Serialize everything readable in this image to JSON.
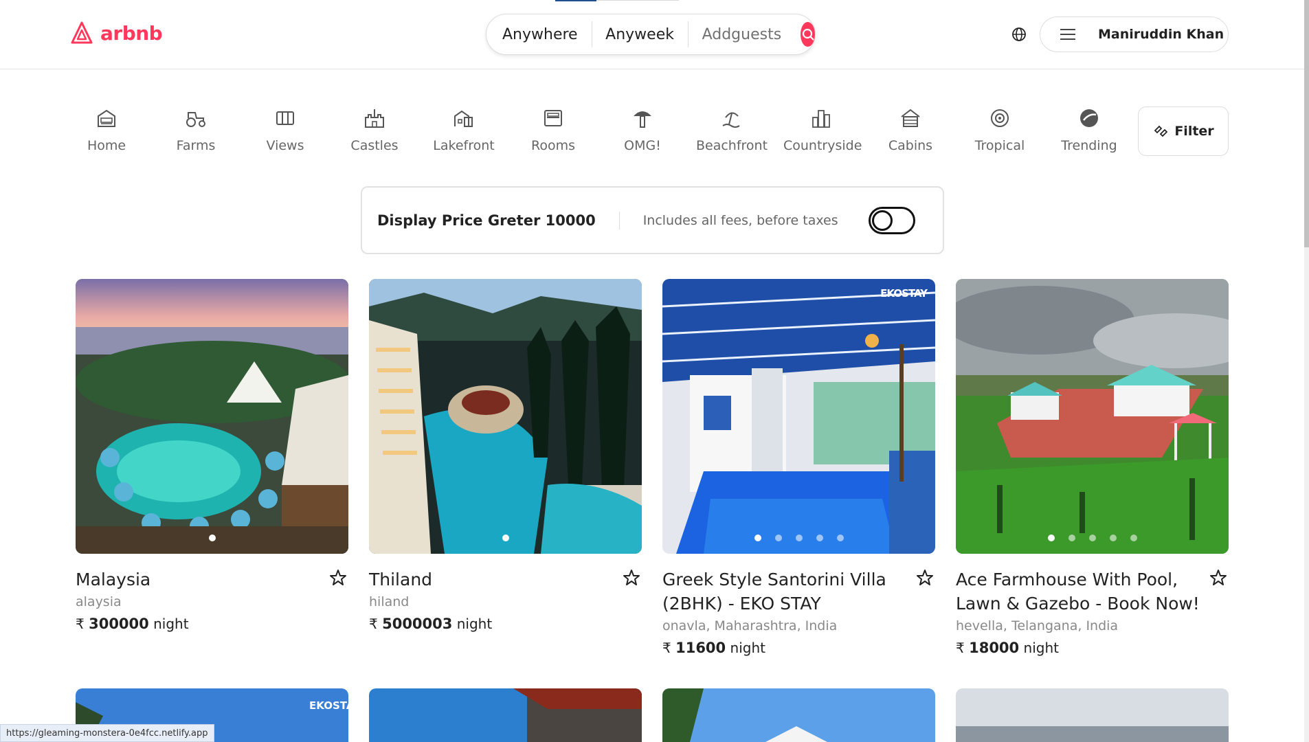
{
  "header": {
    "logo_text": "arbnb",
    "search": {
      "anywhere": "Anywhere",
      "anyweek": "Anyweek",
      "addguests": "Addguests"
    },
    "user_name": "Maniruddin Khan"
  },
  "categories": [
    {
      "label": "Home",
      "icon": "house-icon"
    },
    {
      "label": "Farms",
      "icon": "tractor-icon"
    },
    {
      "label": "Views",
      "icon": "columns-icon"
    },
    {
      "label": "Castles",
      "icon": "castle-icon"
    },
    {
      "label": "Lakefront",
      "icon": "lakefront-icon"
    },
    {
      "label": "Rooms",
      "icon": "bed-icon"
    },
    {
      "label": "OMG!",
      "icon": "mushroom-icon"
    },
    {
      "label": "Beachfront",
      "icon": "beach-icon"
    },
    {
      "label": "Countryside",
      "icon": "city-icon"
    },
    {
      "label": "Cabins",
      "icon": "cabin-icon"
    },
    {
      "label": "Tropical",
      "icon": "tropical-icon"
    },
    {
      "label": "Trending",
      "icon": "trending-icon"
    }
  ],
  "filter_label": "Filter",
  "price_bar": {
    "title": "Display Price Greter 10000",
    "subtitle": "Includes all fees, before taxes",
    "toggle_on": false
  },
  "currency_symbol": "₹",
  "listings": [
    {
      "title": "Malaysia",
      "location": "alaysia",
      "price": "300000",
      "unit": "night",
      "dots": 1,
      "active_dot": 0,
      "watermark": ""
    },
    {
      "title": "Thiland",
      "location": "hiland",
      "price": "5000003",
      "unit": "night",
      "dots": 1,
      "active_dot": 0,
      "watermark": ""
    },
    {
      "title": "Greek Style Santorini Villa (2BHK) - EKO STAY",
      "location": "onavla, Maharashtra, India",
      "price": "11600",
      "unit": "night",
      "dots": 5,
      "active_dot": 0,
      "watermark": "EKOSTAY"
    },
    {
      "title": "Ace Farmhouse With Pool, Lawn & Gazebo - Book Now!",
      "location": "hevella, Telangana, India",
      "price": "18000",
      "unit": "night",
      "dots": 5,
      "active_dot": 0,
      "watermark": ""
    }
  ],
  "row2_watermark": "EKOSTAY",
  "status_url": "https://gleaming-monstera-0e4fcc.netlify.app",
  "colors": {
    "brand": "#ff385c",
    "text": "#222222",
    "muted": "#717171"
  }
}
